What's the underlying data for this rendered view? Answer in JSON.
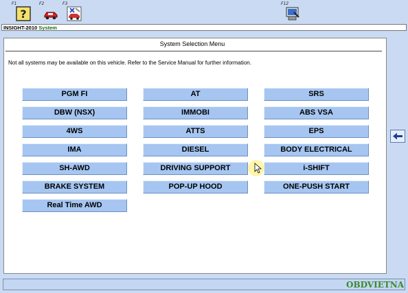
{
  "toolbar": {
    "keys": [
      {
        "label": "F1",
        "icon": "help-question-icon"
      },
      {
        "label": "F2",
        "icon": "car-icon"
      },
      {
        "label": "F3",
        "icon": "car-tools-icon"
      },
      {
        "label": "F12",
        "icon": "print-screen-icon"
      }
    ]
  },
  "breadcrumb": {
    "model": "INSIGHT-2010",
    "section": "System"
  },
  "menu": {
    "title": "System Selection Menu",
    "notice": "Not all systems may be available on this vehicle. Refer to the Service Manual for further information.",
    "columns": [
      [
        "PGM FI",
        "DBW (NSX)",
        "4WS",
        "IMA",
        "SH-AWD",
        "BRAKE SYSTEM",
        "Real Time AWD"
      ],
      [
        "AT",
        "IMMOBI",
        "ATTS",
        "DIESEL",
        "DRIVING SUPPORT",
        "POP-UP HOOD"
      ],
      [
        "SRS",
        "ABS VSA",
        "EPS",
        "BODY ELECTRICAL",
        "i-SHIFT",
        "ONE-PUSH START"
      ]
    ]
  },
  "back_button": {
    "icon": "left-arrow-icon"
  },
  "watermark": {
    "text": "OBDVIETNAM",
    "color": "#3a8a2a"
  },
  "colors": {
    "background": "#c9daf2",
    "button": "#a6c6f1",
    "panel": "#ffffff"
  }
}
